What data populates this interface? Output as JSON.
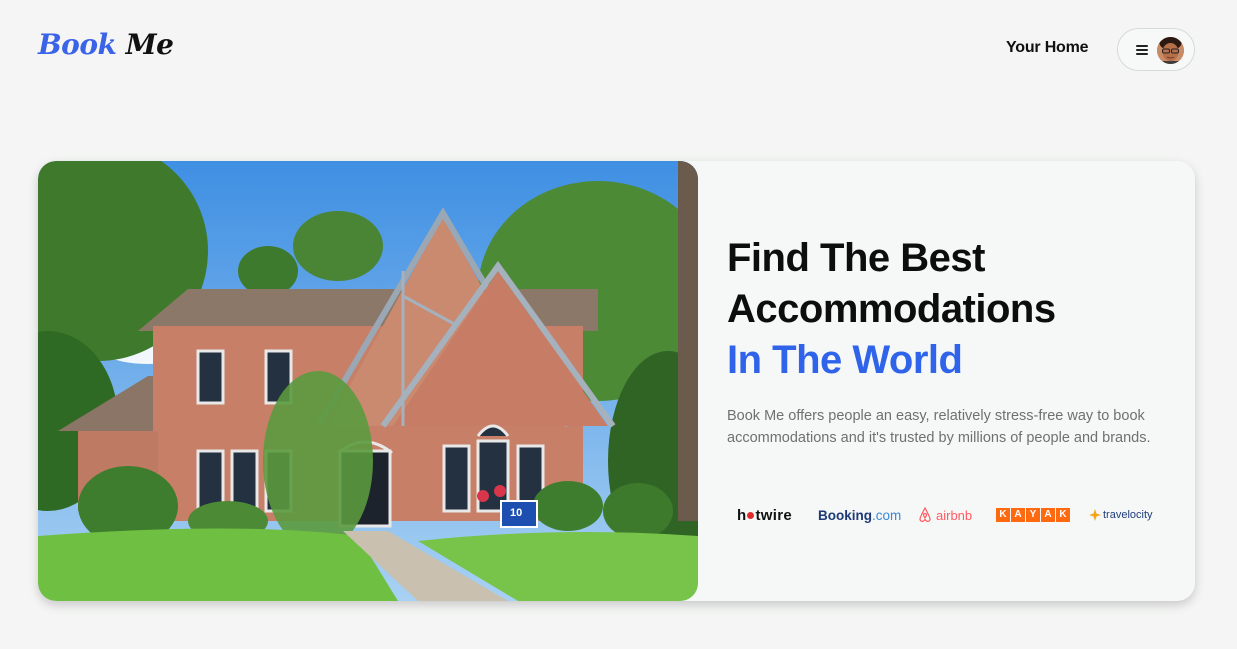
{
  "header": {
    "logo_part1": "Book",
    "logo_part2": "Me",
    "your_home": "Your Home",
    "menu_icon": "hamburger-icon",
    "avatar_icon": "user-avatar"
  },
  "hero": {
    "title_line1": "Find The Best",
    "title_line2": "Accommodations",
    "title_accent": "In The World",
    "description": "Book Me offers people an easy, relatively stress-free way to book accommodations and it's trusted by millions of people and brands.",
    "image_icon": "house-photo",
    "sign_number": "10"
  },
  "brands": {
    "hotwire_a": "h",
    "hotwire_b": "twire",
    "booking": "Booking",
    "booking_com": ".com",
    "airbnb": "airbnb",
    "kayak": [
      "K",
      "A",
      "Y",
      "A",
      "K"
    ],
    "travelocity": "travelocity"
  },
  "colors": {
    "accent": "#2f64ea",
    "background": "#f4f5f4",
    "hotwire_dot": "#e32a2a",
    "airbnb": "#ff5a5f",
    "kayak": "#ff690f",
    "booking": "#1d3a78"
  }
}
